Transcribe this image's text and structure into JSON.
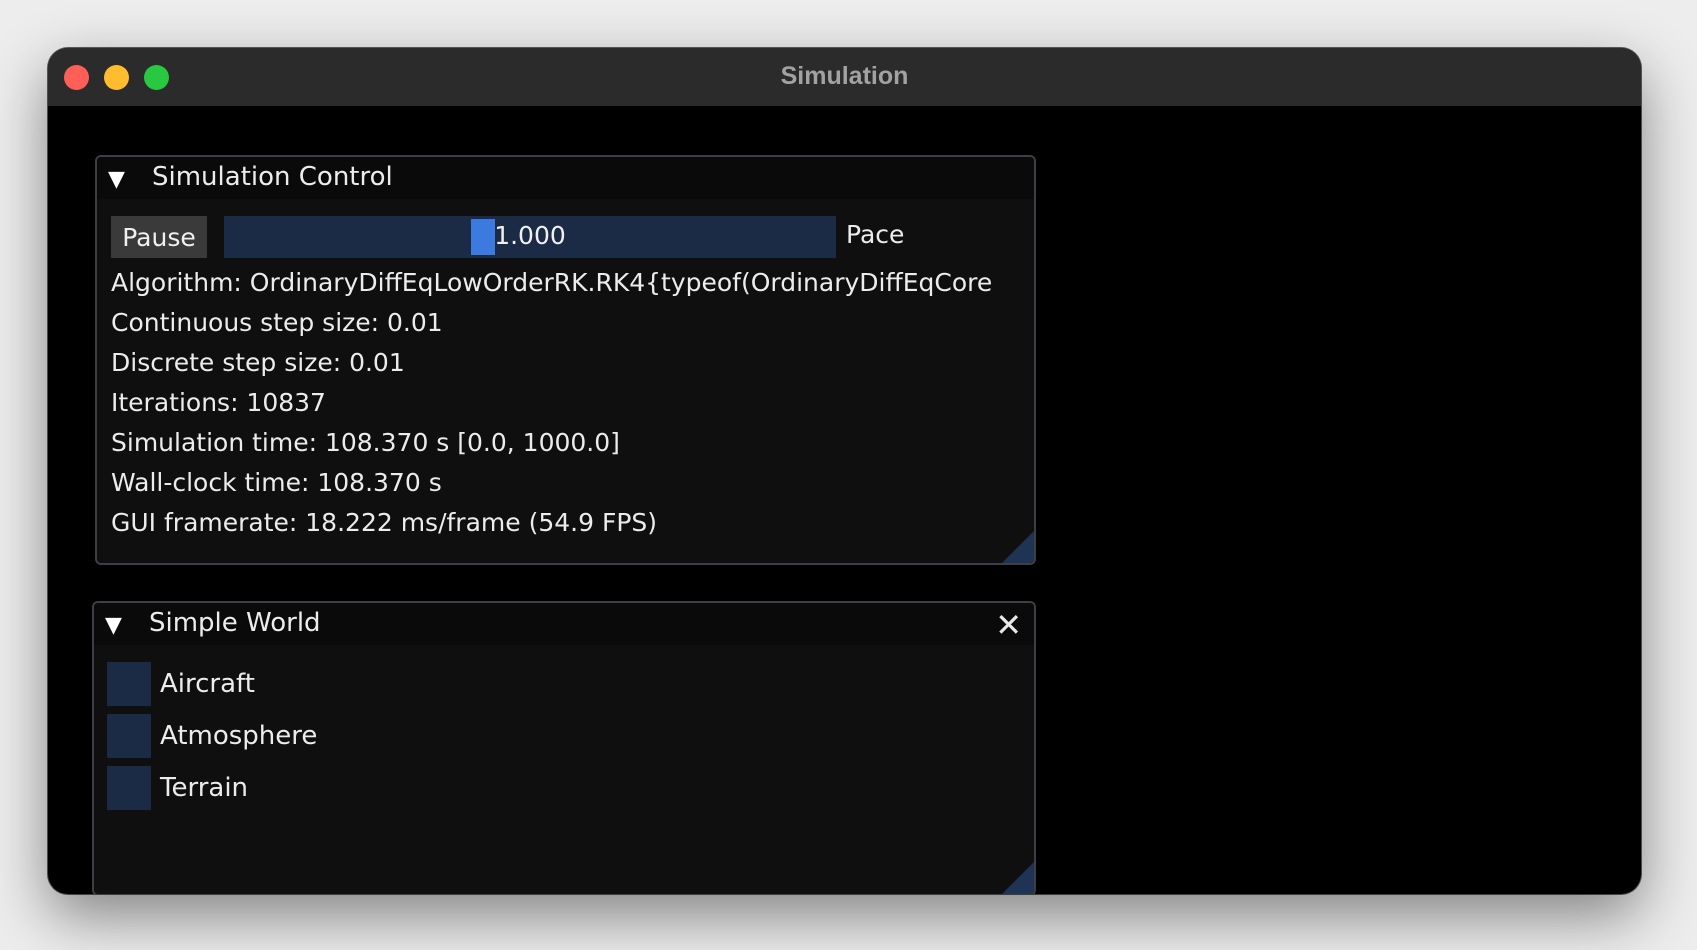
{
  "window": {
    "title": "Simulation"
  },
  "sim_control": {
    "title": "Simulation Control",
    "pause_label": "Pause",
    "pace_value": "1.000",
    "pace_fraction": 0.42,
    "pace_label": "Pace",
    "lines": [
      "Algorithm: OrdinaryDiffEqLowOrderRK.RK4{typeof(OrdinaryDiffEqCore",
      "Continuous step size: 0.01",
      "Discrete step size: 0.01",
      "Iterations: 10837",
      "Simulation time: 108.370 s [0.0, 1000.0]",
      "Wall-clock time: 108.370 s",
      "GUI framerate: 18.222 ms/frame (54.9 FPS)"
    ]
  },
  "simple_world": {
    "title": "Simple World",
    "items": [
      "Aircraft",
      "Atmosphere",
      "Terrain"
    ]
  },
  "colors": {
    "window_bg": "#000000",
    "panel_bg": "#0f0f0f",
    "frame_bg": "#1b2b45",
    "slider_grab": "#3d7ae0",
    "button_bg": "#3a3a3a"
  },
  "icons": {
    "collapse": "triangle-down-icon",
    "close": "close-icon",
    "resize": "resize-grip-icon"
  }
}
